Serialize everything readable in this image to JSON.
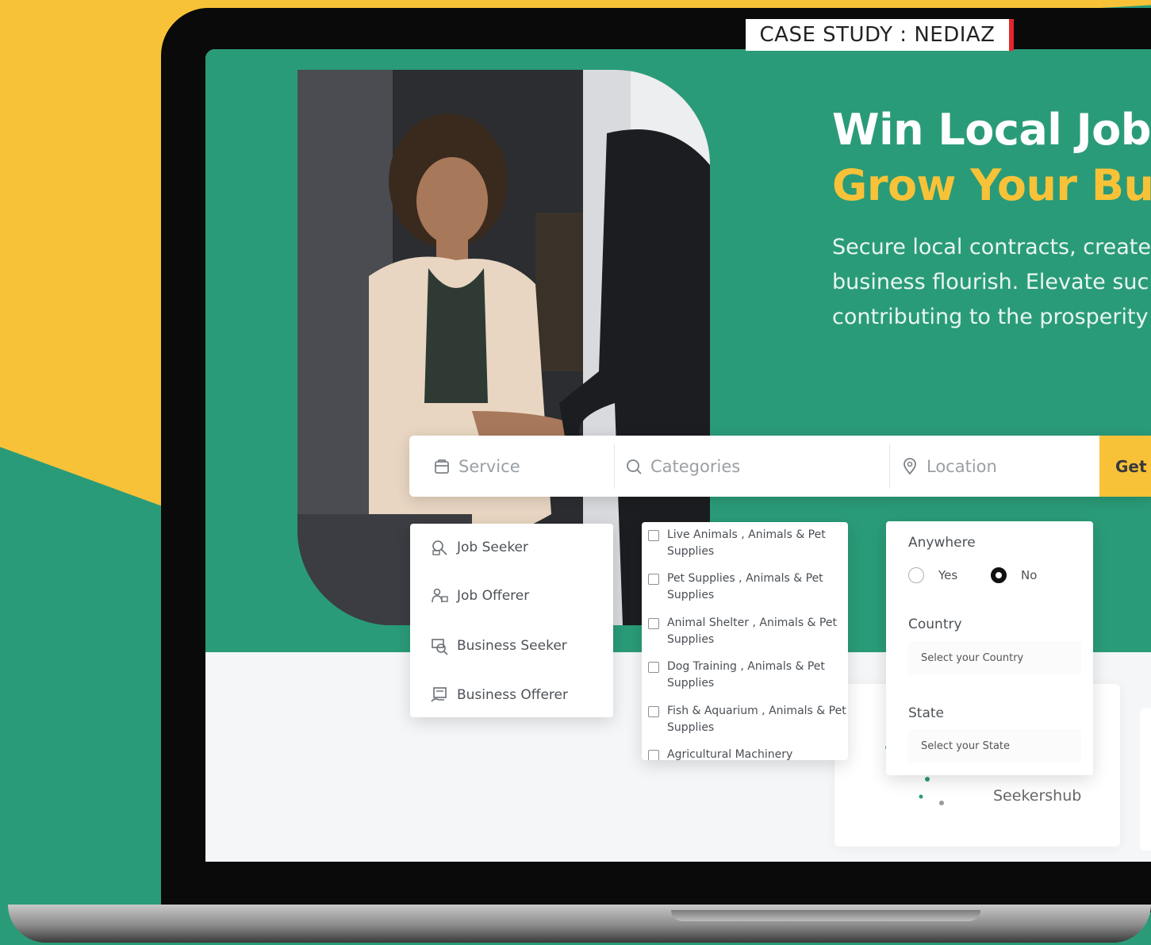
{
  "case_tag": "CASE STUDY : NEDIAZ",
  "hero": {
    "title": "Win Local Jobs",
    "subtitle": "Grow Your Bus",
    "description_lines": [
      "Secure local contracts, create",
      "business flourish. Elevate suc",
      "contributing to the prosperity"
    ]
  },
  "search": {
    "service_placeholder": "Service",
    "categories_placeholder": "Categories",
    "location_placeholder": "Location",
    "button_label": "Get"
  },
  "service_menu": [
    {
      "label": "Job Seeker",
      "icon": "job-seeker-icon"
    },
    {
      "label": "Job Offerer",
      "icon": "job-offerer-icon"
    },
    {
      "label": "Business Seeker",
      "icon": "business-seeker-icon"
    },
    {
      "label": "Business Offerer",
      "icon": "business-offerer-icon"
    }
  ],
  "categories": [
    {
      "line1": "Live Animals , Animals & Pet",
      "line2": "Supplies"
    },
    {
      "line1": "Pet Supplies , Animals & Pet",
      "line2": "Supplies"
    },
    {
      "line1": "Animal Shelter , Animals & Pet",
      "line2": "Supplies"
    },
    {
      "line1": "Dog Training , Animals & Pet",
      "line2": "Supplies"
    },
    {
      "line1": "Fish & Aquarium , Animals & Pet",
      "line2": "Supplies"
    },
    {
      "line1": "Agricultural Machinery",
      "line2": ""
    }
  ],
  "location_panel": {
    "anywhere_label": "Anywhere",
    "yes_label": "Yes",
    "no_label": "No",
    "selected": "No",
    "country_label": "Country",
    "country_placeholder": "Select your Country",
    "state_label": "State",
    "state_placeholder": "Select your State"
  },
  "lower_card": {
    "label": "Seekershub"
  },
  "colors": {
    "green": "#2a9b78",
    "yellow": "#f8c238",
    "red_accent": "#e3262c"
  }
}
